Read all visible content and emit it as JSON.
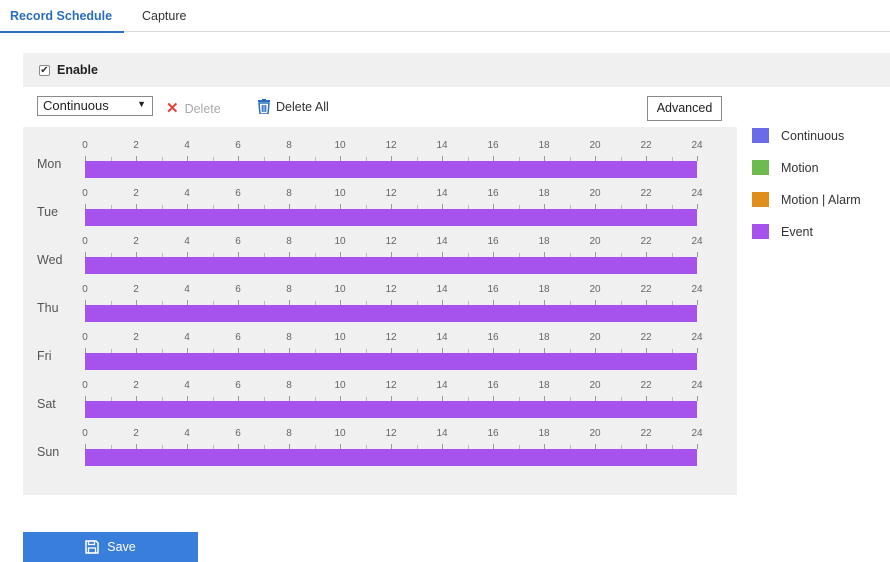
{
  "tabs": [
    {
      "label": "Record Schedule",
      "active": true
    },
    {
      "label": "Capture",
      "active": false
    }
  ],
  "enable": {
    "label": "Enable",
    "checked": true
  },
  "toolbar": {
    "mode_selected": "Continuous",
    "delete_label": "Delete",
    "delete_all_label": "Delete All",
    "advanced_label": "Advanced"
  },
  "schedule": {
    "tick_labels": [
      "0",
      "2",
      "4",
      "6",
      "8",
      "10",
      "12",
      "14",
      "16",
      "18",
      "20",
      "22",
      "24"
    ],
    "days": [
      {
        "label": "Mon",
        "segments": [
          {
            "start": 0,
            "end": 24,
            "type": "Event"
          }
        ]
      },
      {
        "label": "Tue",
        "segments": [
          {
            "start": 0,
            "end": 24,
            "type": "Event"
          }
        ]
      },
      {
        "label": "Wed",
        "segments": [
          {
            "start": 0,
            "end": 24,
            "type": "Event"
          }
        ]
      },
      {
        "label": "Thu",
        "segments": [
          {
            "start": 0,
            "end": 24,
            "type": "Event"
          }
        ]
      },
      {
        "label": "Fri",
        "segments": [
          {
            "start": 0,
            "end": 24,
            "type": "Event"
          }
        ]
      },
      {
        "label": "Sat",
        "segments": [
          {
            "start": 0,
            "end": 24,
            "type": "Event"
          }
        ]
      },
      {
        "label": "Sun",
        "segments": [
          {
            "start": 0,
            "end": 24,
            "type": "Event"
          }
        ]
      }
    ]
  },
  "legend": [
    {
      "label": "Continuous",
      "color": "#6b6be8"
    },
    {
      "label": "Motion",
      "color": "#6dbb4f"
    },
    {
      "label": "Motion | Alarm",
      "color": "#e08e1b"
    },
    {
      "label": "Event",
      "color": "#a653ee"
    }
  ],
  "save_label": "Save"
}
